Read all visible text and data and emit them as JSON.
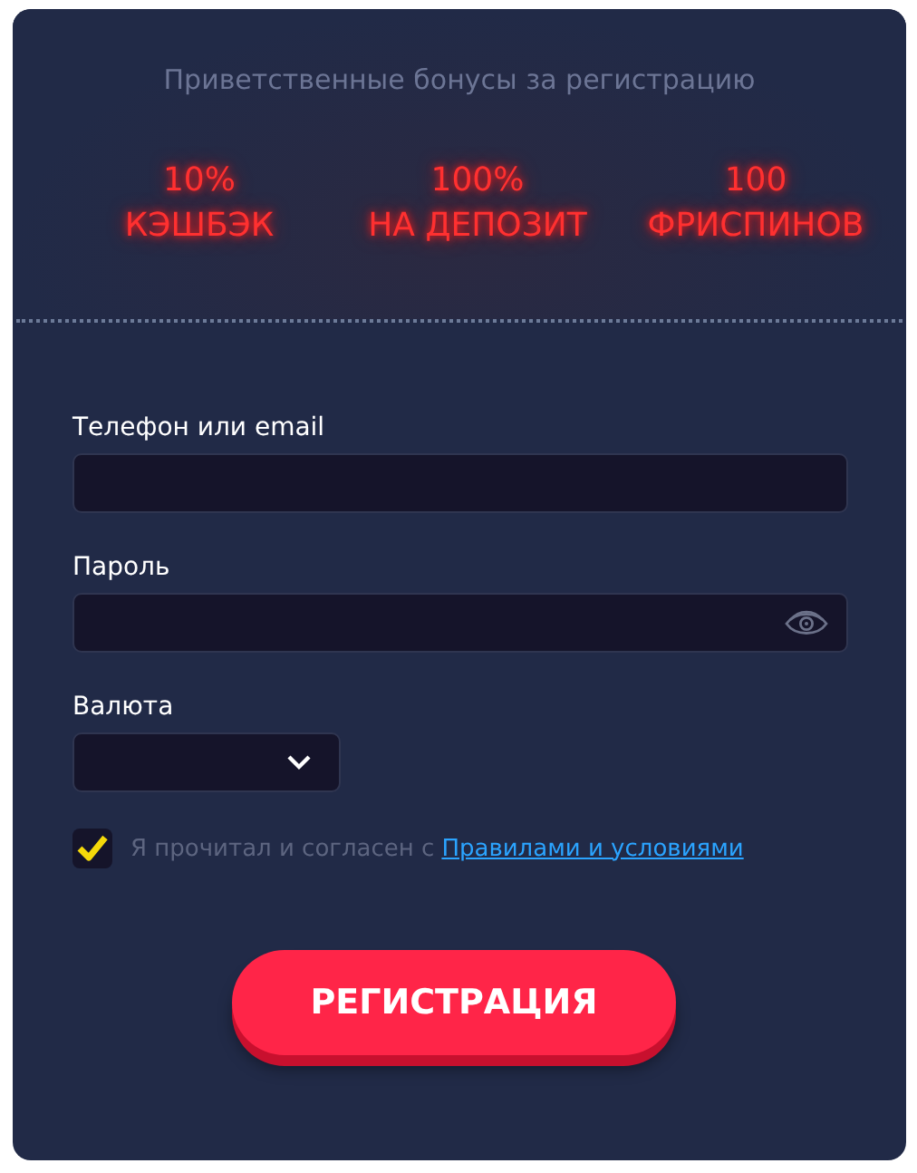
{
  "heading": "Приветственные бонусы за регистрацию",
  "bonuses": [
    {
      "amount": "10%",
      "label": "КЭШБЭК"
    },
    {
      "amount": "100%",
      "label": "НА ДЕПОЗИТ"
    },
    {
      "amount": "100",
      "label": "ФРИСПИНОВ"
    }
  ],
  "fields": [
    {
      "kind": "text",
      "label": "Телефон или email"
    },
    {
      "kind": "password",
      "label": "Пароль"
    },
    {
      "kind": "select",
      "label": "Валюта"
    }
  ],
  "agreement": {
    "checked": true,
    "text": "Я прочитал и согласен с",
    "link": "Правилами и условиями"
  },
  "submit": "РЕГИСТРАЦИЯ"
}
